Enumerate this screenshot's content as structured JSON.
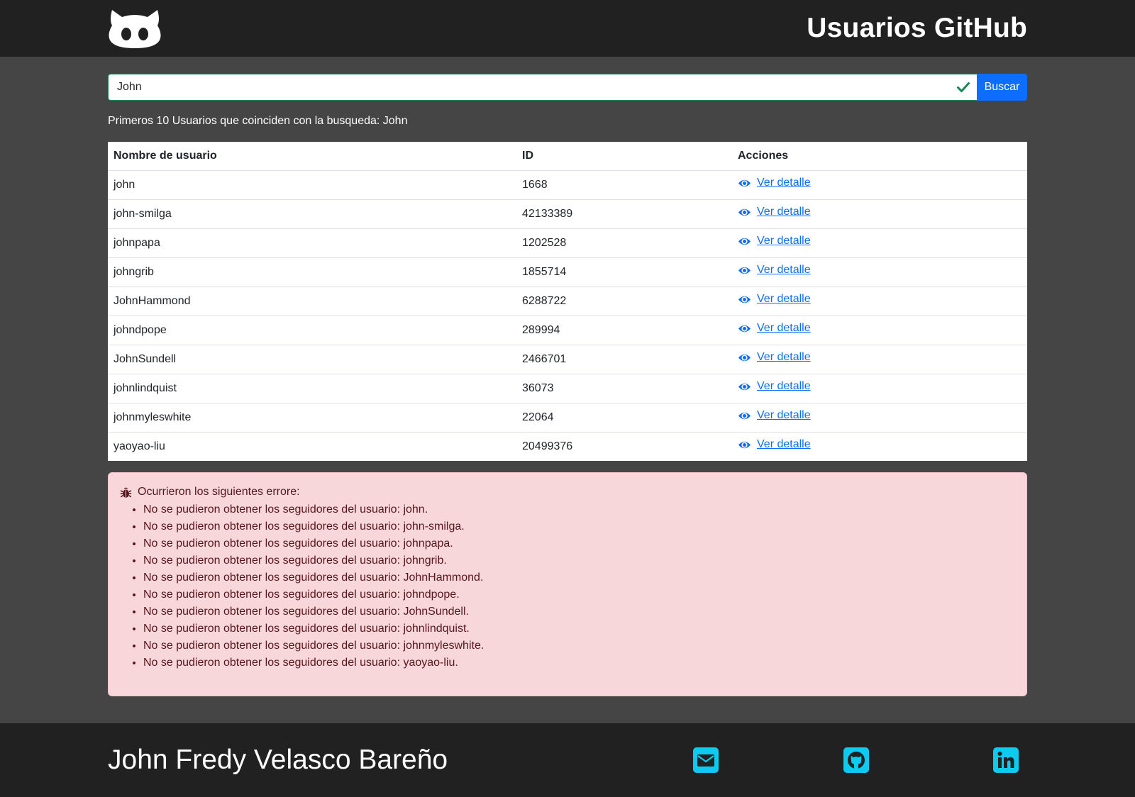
{
  "header": {
    "title": "Usuarios GitHub",
    "logo_icon": "github-octocat-icon"
  },
  "search": {
    "value": "John",
    "placeholder": "",
    "button_label": "Buscar",
    "valid_icon": "check-icon"
  },
  "results_caption": "Primeros 10 Usuarios que coinciden con la busqueda: John",
  "table": {
    "headers": [
      "Nombre de usuario",
      "ID",
      "Acciones"
    ],
    "action_label": "Ver detalle",
    "action_icon": "eye-icon",
    "rows": [
      {
        "username": "john",
        "id": "1668"
      },
      {
        "username": "john-smilga",
        "id": "42133389"
      },
      {
        "username": "johnpapa",
        "id": "1202528"
      },
      {
        "username": "johngrib",
        "id": "1855714"
      },
      {
        "username": "JohnHammond",
        "id": "6288722"
      },
      {
        "username": "johndpope",
        "id": "289994"
      },
      {
        "username": "JohnSundell",
        "id": "2466701"
      },
      {
        "username": "johnlindquist",
        "id": "36073"
      },
      {
        "username": "johnmyleswhite",
        "id": "22064"
      },
      {
        "username": "yaoyao-liu",
        "id": "20499376"
      }
    ]
  },
  "errors": {
    "icon": "bug-icon",
    "title": "Ocurrieron los siguientes errore:",
    "items": [
      "No se pudieron obtener los seguidores del usuario: john.",
      "No se pudieron obtener los seguidores del usuario: john-smilga.",
      "No se pudieron obtener los seguidores del usuario: johnpapa.",
      "No se pudieron obtener los seguidores del usuario: johngrib.",
      "No se pudieron obtener los seguidores del usuario: JohnHammond.",
      "No se pudieron obtener los seguidores del usuario: johndpope.",
      "No se pudieron obtener los seguidores del usuario: JohnSundell.",
      "No se pudieron obtener los seguidores del usuario: johnlindquist.",
      "No se pudieron obtener los seguidores del usuario: johnmyleswhite.",
      "No se pudieron obtener los seguidores del usuario: yaoyao-liu."
    ]
  },
  "footer": {
    "author": "John Fredy Velasco Bareño",
    "social_icons": [
      "mail-icon",
      "github-icon",
      "linkedin-icon"
    ]
  },
  "colors": {
    "header_bg": "#212121",
    "page_bg": "#454545",
    "primary": "#0d6efd",
    "valid": "#198754",
    "alert_bg": "#f8d7da",
    "social": "#0dcaf0"
  }
}
